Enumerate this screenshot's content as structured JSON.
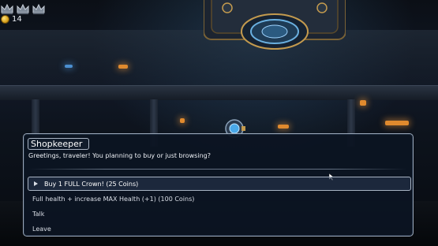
{
  "hud": {
    "crown_icons": [
      "crown-icon",
      "crown-icon",
      "crown-icon"
    ],
    "coin_icon": "coin-icon",
    "coins": "14"
  },
  "dialog": {
    "speaker": "Shopkeeper",
    "message": "Greetings, traveler! You planning to buy or just browsing?",
    "selected_index": 0,
    "options": [
      {
        "label": "Buy 1 FULL Crown! (25 Coins)"
      },
      {
        "label": "Full health + increase MAX Health (+1) (100 Coins)"
      },
      {
        "label": "Talk"
      },
      {
        "label": "Leave"
      }
    ]
  },
  "colors": {
    "dialog_bg": "#0c1422",
    "dialog_border": "#9aa7b8",
    "text": "#eef1f6",
    "coin": "#d8a21c"
  }
}
